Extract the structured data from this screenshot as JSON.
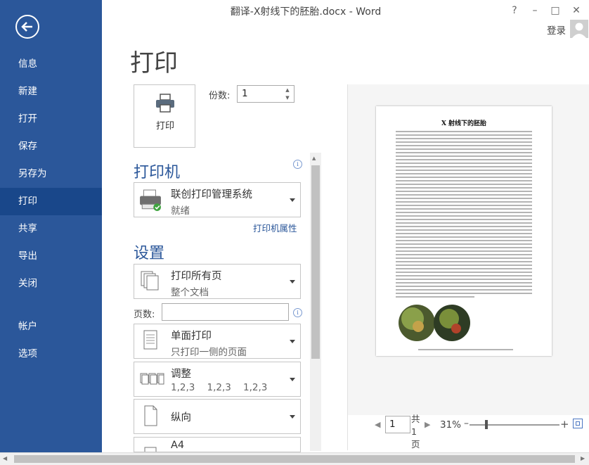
{
  "window": {
    "title": "翻译-X射线下的胚胎.docx - Word",
    "help": "?",
    "minimize": "–",
    "maximize": "□",
    "close": "✕",
    "login": "登录"
  },
  "sidebar": {
    "back_icon": "arrow-left-icon",
    "items": [
      {
        "label": "信息"
      },
      {
        "label": "新建"
      },
      {
        "label": "打开"
      },
      {
        "label": "保存"
      },
      {
        "label": "另存为"
      },
      {
        "label": "打印"
      },
      {
        "label": "共享"
      },
      {
        "label": "导出"
      },
      {
        "label": "关闭"
      },
      {
        "label": "帐户"
      },
      {
        "label": "选项"
      }
    ],
    "active_index": 5
  },
  "print": {
    "title": "打印",
    "print_button": "打印",
    "copies_label": "份数:",
    "copies_value": "1"
  },
  "printer": {
    "heading": "打印机",
    "name": "联创打印管理系统",
    "status": "就绪",
    "properties_link": "打印机属性"
  },
  "settings": {
    "heading": "设置",
    "range": {
      "title": "打印所有页",
      "subtitle": "整个文档"
    },
    "pages_label": "页数:",
    "pages_value": "",
    "sides": {
      "title": "单面打印",
      "subtitle": "只打印一侧的页面"
    },
    "collate": {
      "title": "调整",
      "subtitle": "1,2,3    1,2,3    1,2,3"
    },
    "orientation": {
      "title": "纵向"
    },
    "paper_size": {
      "title": "A4"
    }
  },
  "preview": {
    "doc_title": "X 射线下的胚胎",
    "page_current": "1",
    "page_total": "共 1 页",
    "zoom": "31%",
    "zoom_minus": "–",
    "zoom_plus": "+"
  },
  "colors": {
    "sidebar": "#2b579a",
    "sidebar_active": "#19478a",
    "accent": "#2b579a"
  }
}
